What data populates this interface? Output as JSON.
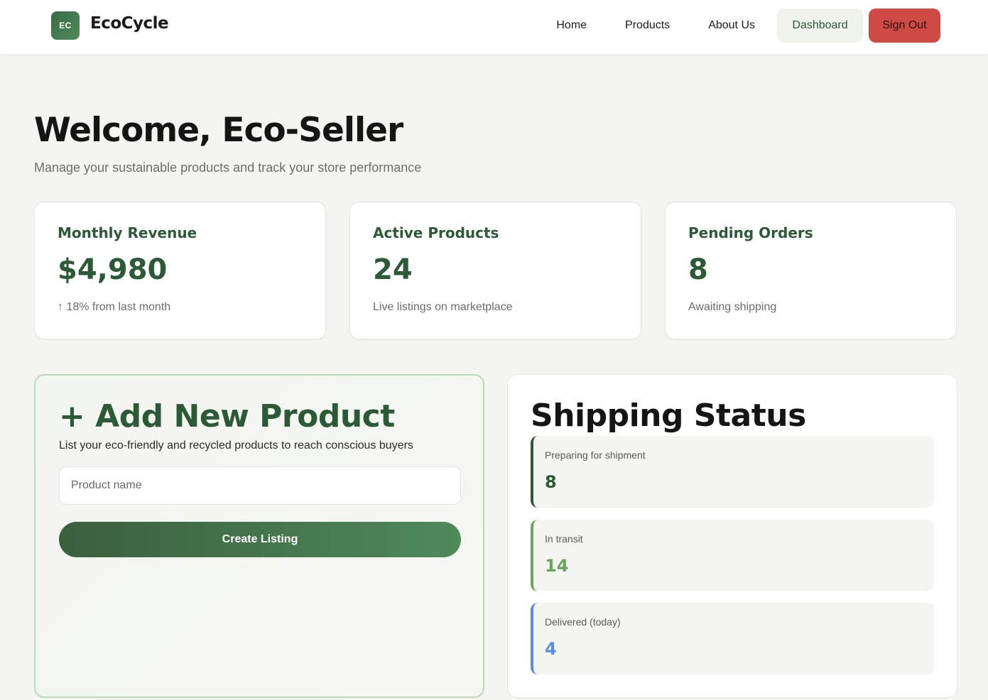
{
  "brand": {
    "logo_initials": "EC",
    "name": "EcoCycle",
    "accent_color": "#2d5a36"
  },
  "nav": {
    "home": "Home",
    "products": "Products",
    "about": "About Us",
    "dashboard": "Dashboard",
    "signout": "Sign Out"
  },
  "hero": {
    "title": "Welcome, Eco-Seller",
    "subtitle": "Manage your sustainable products and track your store performance"
  },
  "stats": [
    {
      "label": "Monthly Revenue",
      "value": "$4,980",
      "note": "↑ 18% from last month"
    },
    {
      "label": "Active Products",
      "value": "24",
      "note": "Live listings on marketplace"
    },
    {
      "label": "Pending Orders",
      "value": "8",
      "note": "Awaiting shipping"
    }
  ],
  "add_product": {
    "title": "+ Add New Product",
    "description": "List your eco-friendly and recycled products to reach conscious buyers",
    "input_placeholder": "Product name",
    "input_value": "",
    "button_label": "Create Listing"
  },
  "shipping": {
    "title": "Shipping Status",
    "items": [
      {
        "label": "Preparing for shipment",
        "value": "8",
        "color": "#2d5a36"
      },
      {
        "label": "In transit",
        "value": "14",
        "color": "#6aa65e"
      },
      {
        "label": "Delivered (today)",
        "value": "4",
        "color": "#5b8ee0"
      }
    ]
  }
}
